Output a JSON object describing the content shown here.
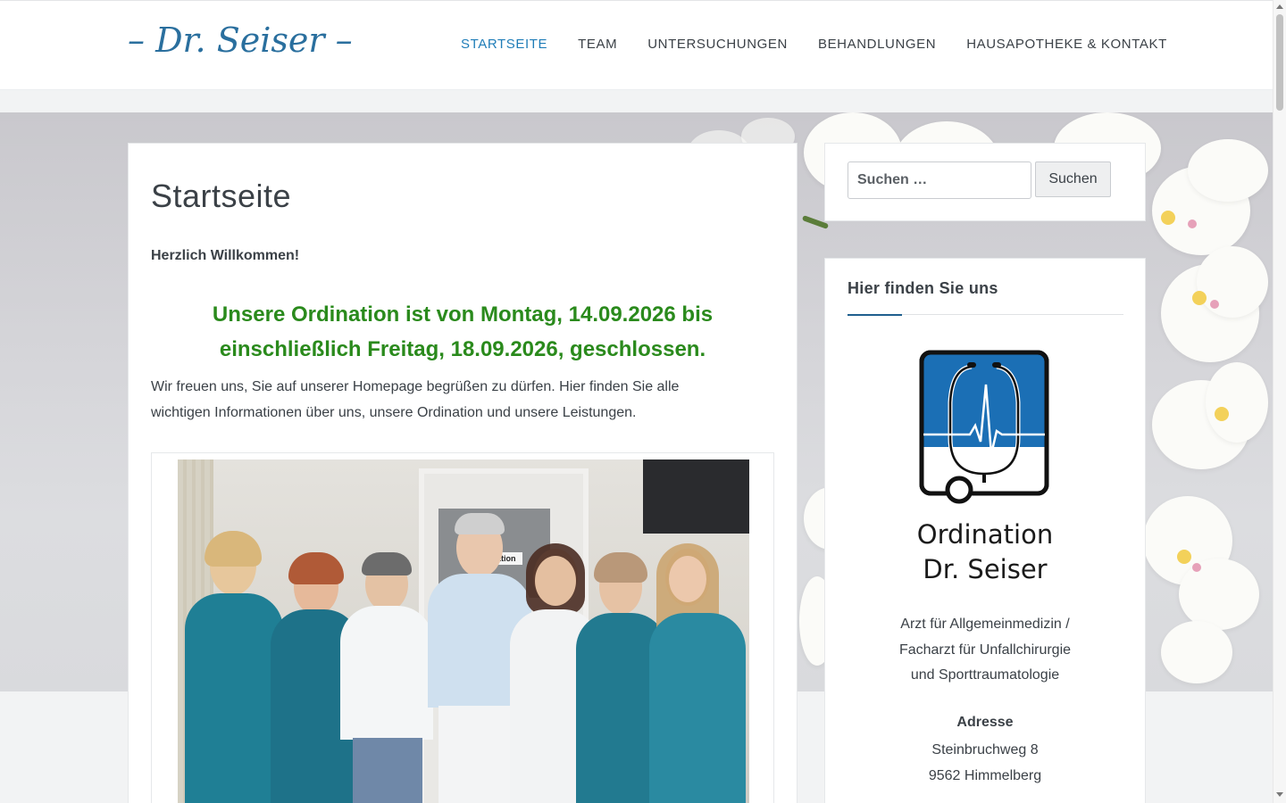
{
  "header": {
    "logo": "– Dr. Seiser –",
    "nav": [
      {
        "label": "STARTSEITE",
        "active": true
      },
      {
        "label": "TEAM",
        "active": false
      },
      {
        "label": "UNTERSUCHUNGEN",
        "active": false
      },
      {
        "label": "BEHANDLUNGEN",
        "active": false
      },
      {
        "label": "HAUSAPOTHEKE & KONTAKT",
        "active": false
      }
    ]
  },
  "main": {
    "title": "Startseite",
    "welcome": "Herzlich Willkommen!",
    "notice_line1": "Unsere Ordination ist von Montag, 14.09.2026 bis",
    "notice_line2": "einschließlich Freitag, 18.09.2026, geschlossen.",
    "intro_line1": "Wir freuen uns, Sie auf unserer Homepage begrüßen zu dürfen. Hier finden Sie alle",
    "intro_line2": "wichtigen Informationen über uns, unsere Ordination und unsere Leistungen.",
    "photo_sign": "nation"
  },
  "sidebar": {
    "search": {
      "placeholder": "Suchen …",
      "button_label": "Suchen"
    },
    "widget": {
      "title": "Hier finden Sie uns",
      "logo_line1": "Ordination",
      "logo_line2": "Dr. Seiser",
      "subtitle_line1": "Arzt für Allgemeinmedizin /",
      "subtitle_line2": "Facharzt für Unfallchirurgie",
      "subtitle_line3": "und Sporttraumatologie",
      "address_label": "Adresse",
      "address_line1": "Steinbruchweg 8",
      "address_line2": "9562 Himmelberg"
    }
  },
  "colors": {
    "accent": "#1f7db8",
    "notice_green": "#2a8a1c",
    "logo_blue": "#1b6fb5",
    "text": "#3b4147"
  }
}
